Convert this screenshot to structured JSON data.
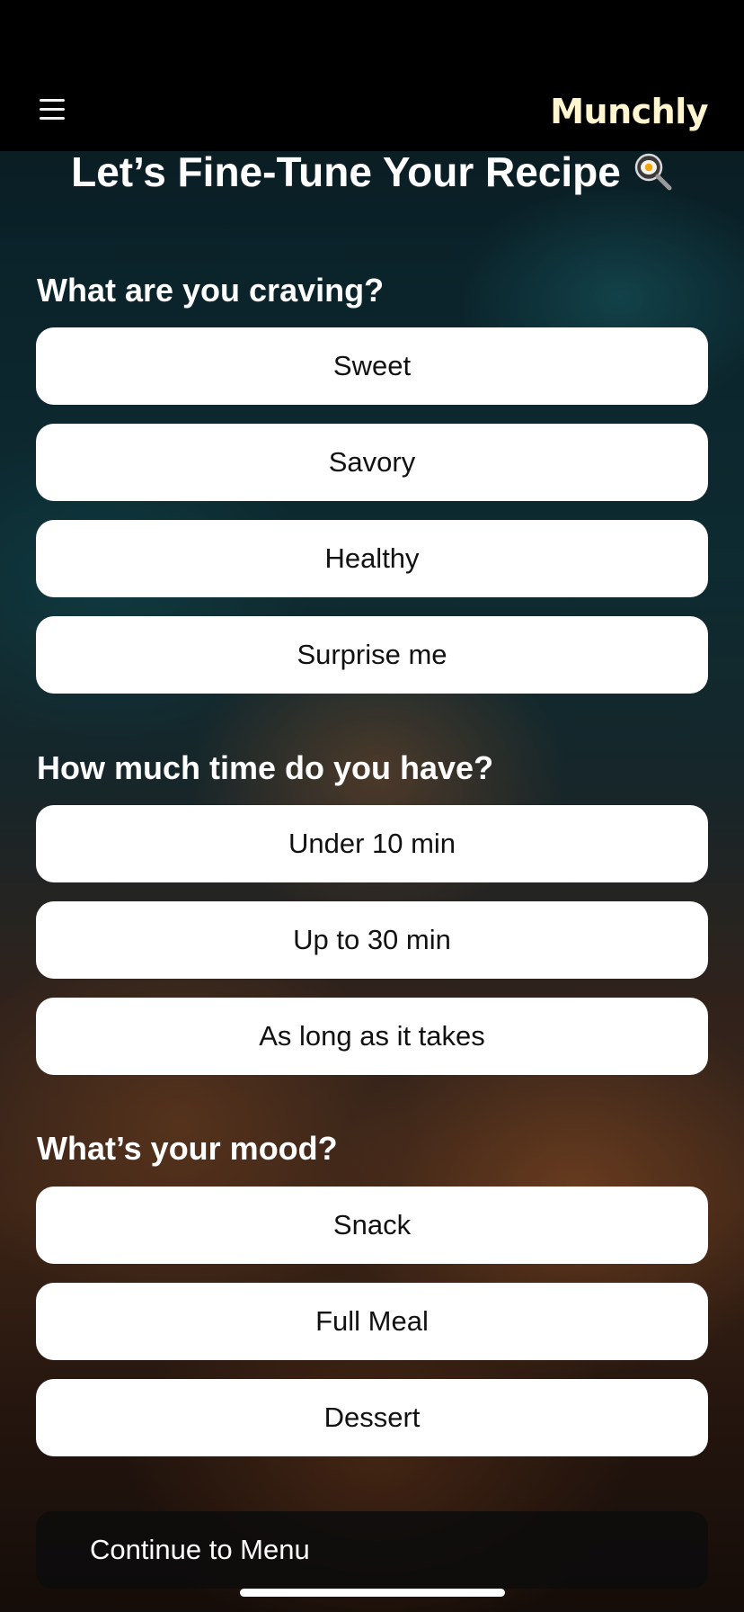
{
  "header": {
    "brand": "Munchly",
    "menu_icon": "hamburger-menu-icon"
  },
  "page": {
    "title": "Let’s Fine-Tune Your Recipe",
    "title_icon": "frying-pan-egg-icon"
  },
  "sections": [
    {
      "label": "What are you craving?",
      "options": [
        "Sweet",
        "Savory",
        "Healthy",
        "Surprise me"
      ]
    },
    {
      "label": "How much time do you have?",
      "options": [
        "Under 10 min",
        "Up to 30 min",
        "As long as it takes"
      ]
    },
    {
      "label": "What’s your mood?",
      "options": [
        "Snack",
        "Full Meal",
        "Dessert"
      ]
    }
  ],
  "footer": {
    "continue_label": "Continue to Menu"
  },
  "colors": {
    "brand_text": "#fff6cf",
    "option_background": "#ffffff",
    "continue_background": "#0c0c0c"
  }
}
